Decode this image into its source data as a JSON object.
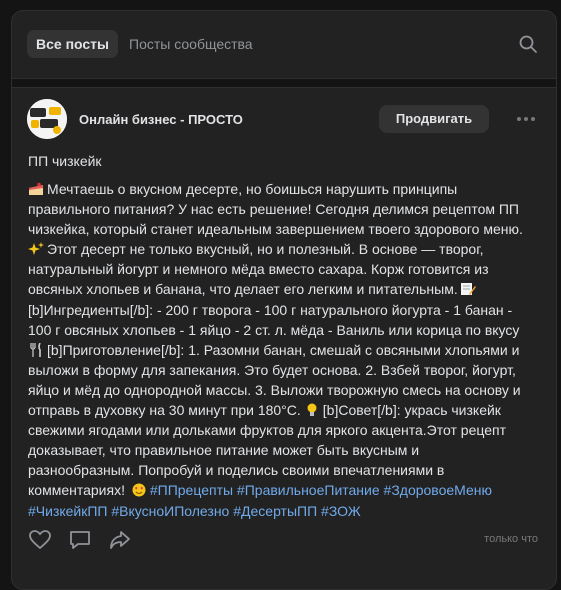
{
  "tabs": {
    "all_posts": "Все посты",
    "community_posts": "Посты сообщества"
  },
  "post": {
    "author": "Онлайн бизнес - ПРОСТО",
    "promote_label": "Продвигать",
    "title": "ПП чизкейк",
    "lines": [
      "Мечтаешь о вкусном десерте, но боишься нарушить принципы",
      "правильного питания? У нас есть решение! Сегодня делимся рецептом ПП",
      "чизкейка, который станет идеальным завершением твоего здорового меню.",
      "Этот десерт не только вкусный, но и полезный. В основе — творог,",
      "натуральный йогурт и немного мёда вместо сахара. Корж готовится из",
      "овсяных хлопьев и банана, что делает его легким и питательным.",
      "[b]Ингредиенты[/b]: - 200 г творога - 100 г натурального йогурта - 1 банан -",
      "100 г овсяных хлопьев - 1 яйцо - 2 ст. л. мёда - Ваниль или корица по вкусу",
      "[b]Приготовление[/b]: 1. Разомни банан, смешай с овсяными хлопьями и",
      "выложи в форму для запекания. Это будет основа. 2. Взбей творог, йогурт,",
      "яйцо и мёд до однородной массы. 3. Выложи творожную смесь на основу и",
      "отправь в духовку на 30 минут при 180°C.",
      "[b]Совет[/b]: укрась чизкейк",
      "свежими ягодами или дольками фруктов для яркого акцента.Этот рецепт",
      "доказывает, что правильное питание может быть вкусным и",
      "разнообразным. Попробуй и поделись своими впечатлениями в",
      "комментариях!"
    ],
    "tags_line1": "#ППрецепты #ПравильноеПитание #ЗдоровоеМеню",
    "tags_line2": "#ЧизкейкПП #ВкусноИПолезно #ДесертыПП #ЗОЖ"
  },
  "footer": {
    "only_that": "только что"
  }
}
